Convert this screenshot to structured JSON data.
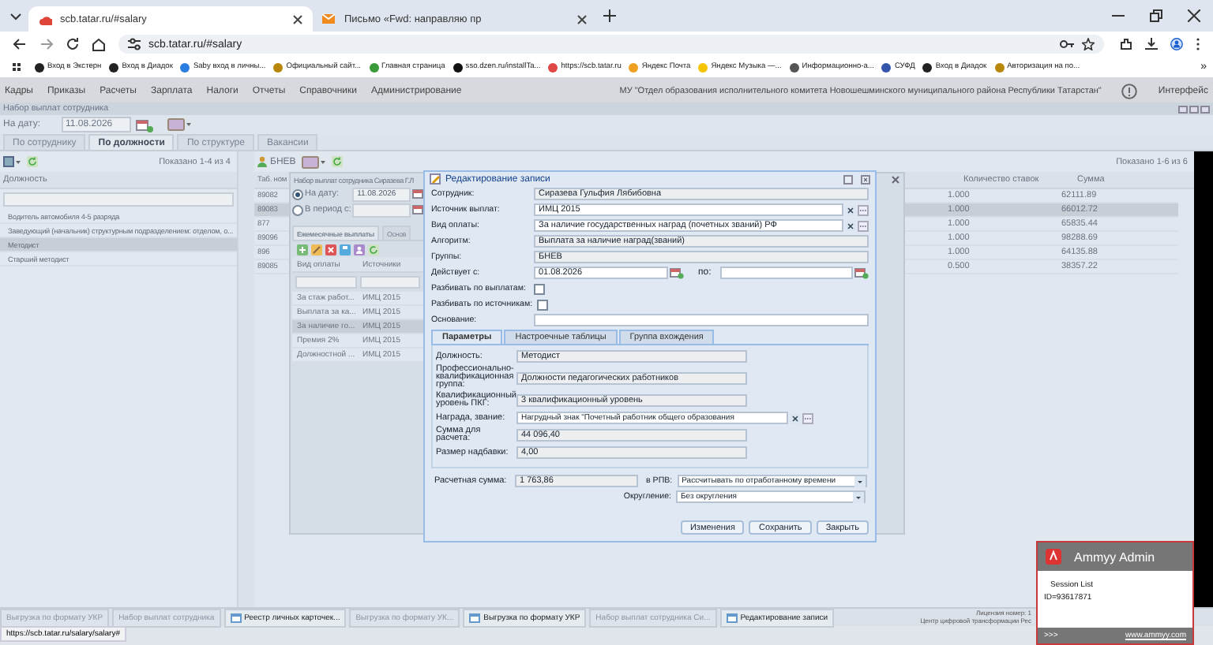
{
  "browser": {
    "tabs": [
      {
        "title": "scb.tatar.ru/#salary",
        "selected": true
      },
      {
        "title": "Письмо «Fwd: направляю пр",
        "selected": false
      }
    ],
    "address": "scb.tatar.ru/#salary",
    "bookmarks": [
      {
        "title": "Вход в Экстерн",
        "color": "#222222"
      },
      {
        "title": "Вход в Диадок",
        "color": "#222222"
      },
      {
        "title": "Saby вход в личны...",
        "color": "#2a7de1"
      },
      {
        "title": "Официальный сайт...",
        "color": "#b8860b"
      },
      {
        "title": "Главная страница",
        "color": "#3a9a3a"
      },
      {
        "title": "sso.dzen.ru/installTa...",
        "color": "#111111"
      },
      {
        "title": "https://scb.tatar.ru",
        "color": "#e04848"
      },
      {
        "title": "Яндекс Почта",
        "color": "#f0a020"
      },
      {
        "title": "Яндекс Музыка —...",
        "color": "#f5c400"
      },
      {
        "title": "Информационно-а...",
        "color": "#555555"
      },
      {
        "title": "СУФД",
        "color": "#3355aa"
      },
      {
        "title": "Вход в Диадок",
        "color": "#222222"
      },
      {
        "title": "Авторизация на по...",
        "color": "#b8860b"
      }
    ],
    "more": "»"
  },
  "app": {
    "menu": [
      "Кадры",
      "Приказы",
      "Расчеты",
      "Зарплата",
      "Налоги",
      "Отчеты",
      "Справочники",
      "Администрирование"
    ],
    "organization": "МУ \"Отдел образования исполнительного комитета Новошешминского муниципального района Республики Татарстан\"",
    "interface_label": "Интерфейс"
  },
  "panel": {
    "title": "Набор выплат сотрудника",
    "date_label": "На дату:",
    "date": "11.08.2026",
    "tabs": [
      {
        "label": "По сотруднику",
        "selected": false
      },
      {
        "label": "По должности",
        "selected": true
      },
      {
        "label": "По структуре",
        "selected": false
      },
      {
        "label": "Вакансии",
        "selected": false
      }
    ]
  },
  "positions": {
    "shown": "Показано 1-4 из 4",
    "column": "Должность",
    "rows": [
      {
        "text": "Водитель автомобиля 4-5 разряда",
        "selected": false
      },
      {
        "text": "Заведующий (начальник) структурным подразделением: отделом, о...",
        "selected": false
      },
      {
        "text": "Методист",
        "selected": true
      },
      {
        "text": "Старший методист",
        "selected": false
      }
    ]
  },
  "employees": {
    "group": "БНЕВ",
    "shown": "Показано 1-6 из 6",
    "columns": [
      "Таб. ном",
      "Количество ставок",
      "Сумма"
    ],
    "rows": [
      {
        "number": "89082",
        "rate": "1.000",
        "sum": "62111.89",
        "selected": false
      },
      {
        "number": "89083",
        "rate": "1.000",
        "sum": "66012.72",
        "selected": true
      },
      {
        "number": "877",
        "rate": "1.000",
        "sum": "65835.44",
        "selected": false
      },
      {
        "number": "89096",
        "rate": "1.000",
        "sum": "98288.69",
        "selected": false
      },
      {
        "number": "896",
        "rate": "1.000",
        "sum": "64135.88",
        "selected": false
      },
      {
        "number": "89085",
        "rate": "0.500",
        "sum": "38357.22",
        "selected": false
      }
    ]
  },
  "payments_window": {
    "title": "Набор выплат сотрудника Сиразева Г.Л",
    "modes": [
      {
        "label": "На дату:",
        "value": "11.08.2026",
        "selected": true
      },
      {
        "label": "В период с:",
        "selected": false
      }
    ],
    "tabs": [
      {
        "label": "Ежемесячные выплаты",
        "selected": true
      },
      {
        "label": "Основ",
        "selected": false
      }
    ],
    "columns": [
      "Вид оплаты",
      "Источники"
    ],
    "rows": [
      {
        "type": "За стаж работ...",
        "source": "ИМЦ 2015",
        "selected": false
      },
      {
        "type": "Выплата за ка...",
        "source": "ИМЦ 2015",
        "selected": false
      },
      {
        "type": "За наличие го...",
        "source": "ИМЦ 2015",
        "selected": true
      },
      {
        "type": "Премия 2%",
        "source": "ИМЦ 2015",
        "selected": false
      },
      {
        "type": "Должностной ...",
        "source": "ИМЦ 2015",
        "selected": false
      }
    ]
  },
  "edit_dialog": {
    "title": "Редактирование записи",
    "fields": [
      {
        "kind": "readonly",
        "label": "Сотрудник:",
        "value": "Сиразева Гульфия Лябибовна"
      },
      {
        "kind": "select",
        "label": "Источник выплат:",
        "value": "ИМЦ 2015"
      },
      {
        "kind": "select",
        "label": "Вид оплаты:",
        "value": "За наличие государственных наград (почетных званий) РФ"
      },
      {
        "kind": "readonly",
        "label": "Алгоритм:",
        "value": "Выплата за наличие наград(званий)"
      },
      {
        "kind": "readonly",
        "label": "Группы:",
        "value": "БНЕВ"
      },
      {
        "kind": "period",
        "label": "Действует с:",
        "value": "01.08.2026",
        "to_label": "по:"
      },
      {
        "kind": "checkbox",
        "label": "Разбивать по выплатам:",
        "checked": false
      },
      {
        "kind": "checkbox",
        "label": "Разбивать по источникам:",
        "checked": false
      },
      {
        "kind": "text",
        "label": "Основание:"
      }
    ],
    "tabs": [
      {
        "label": "Параметры",
        "selected": true
      },
      {
        "label": "Настроечные таблицы",
        "selected": false
      },
      {
        "label": "Группа вхождения",
        "selected": false
      }
    ],
    "parameters": [
      {
        "kind": "readonly",
        "label": "Должность:",
        "value": "Методист"
      },
      {
        "kind": "readonly",
        "label": "Профессионально-квалификационная группа:",
        "value": "Должности педагогических работников"
      },
      {
        "kind": "readonly",
        "label": "Квалификационный уровень ПКГ:",
        "value": "3 квалификационный уровень"
      },
      {
        "kind": "select",
        "label": "Награда, звание:",
        "value": "Нагрудный знак \"Почетный работник общего образования"
      },
      {
        "kind": "readonly",
        "label": "Сумма для расчета:",
        "value": "44 096,40"
      },
      {
        "kind": "readonly",
        "label": "Размер надбавки:",
        "value": "4,00"
      }
    ],
    "calculated": {
      "label": "Расчетная сумма:",
      "value": "1 763,86"
    },
    "options": [
      {
        "label": "в РПВ:",
        "value": "Рассчитывать по отработанному времени"
      },
      {
        "label": "Округление:",
        "value": "Без округления"
      }
    ],
    "buttons": [
      "Изменения",
      "Сохранить",
      "Закрыть"
    ]
  },
  "taskbar": {
    "items": [
      {
        "title": "Выгрузка по формату УКР",
        "dimmed": true
      },
      {
        "title": "Набор выплат сотрудника",
        "dimmed": true
      },
      {
        "title": "Реестр личных карточек...",
        "dimmed": false
      },
      {
        "title": "Выгрузка по формату УК...",
        "dimmed": true
      },
      {
        "title": "Выгрузка по формату УКР",
        "dimmed": false
      },
      {
        "title": "Набор выплат сотрудника Си...",
        "dimmed": true
      },
      {
        "title": "Редактирование записи",
        "dimmed": false
      }
    ],
    "license": [
      "Лицензия номер: 1",
      "Центр цифровой трансформации Рес"
    ]
  },
  "status_url": "https://scb.tatar.ru/salary/salary#",
  "ammyy": {
    "title": "Ammyy Admin",
    "heading": "Session List",
    "id": "ID=93617871",
    "more": ">>>",
    "link": "www.ammyy.com"
  }
}
